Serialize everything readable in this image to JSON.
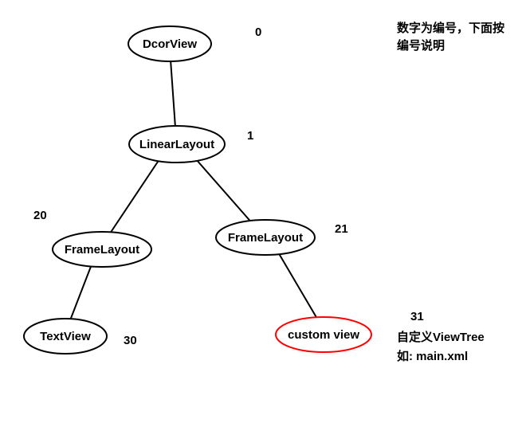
{
  "notes": {
    "top_line1": "数字为编号，下面按",
    "top_line2": "编号说明",
    "custom_line1": "自定义ViewTree",
    "custom_line2": "如: main.xml"
  },
  "nodes": {
    "n0": {
      "label": "DcorView",
      "num": "0"
    },
    "n1": {
      "label": "LinearLayout",
      "num": "1"
    },
    "n20": {
      "label": "FrameLayout",
      "num": "20"
    },
    "n21": {
      "label": "FrameLayout",
      "num": "21"
    },
    "n30": {
      "label": "TextView",
      "num": "30"
    },
    "n31": {
      "label": "custom view",
      "num": "31"
    }
  },
  "chart_data": {
    "type": "tree",
    "title": "",
    "nodes": [
      {
        "id": 0,
        "label": "DcorView",
        "highlight": false
      },
      {
        "id": 1,
        "label": "LinearLayout",
        "highlight": false
      },
      {
        "id": 20,
        "label": "FrameLayout",
        "highlight": false
      },
      {
        "id": 21,
        "label": "FrameLayout",
        "highlight": false
      },
      {
        "id": 30,
        "label": "TextView",
        "highlight": false
      },
      {
        "id": 31,
        "label": "custom view",
        "highlight": true
      }
    ],
    "edges": [
      {
        "from": 0,
        "to": 1
      },
      {
        "from": 1,
        "to": 20
      },
      {
        "from": 1,
        "to": 21
      },
      {
        "from": 20,
        "to": 30
      },
      {
        "from": 21,
        "to": 31
      }
    ],
    "annotations": [
      "数字为编号，下面按编号说明",
      "自定义ViewTree 如: main.xml"
    ]
  }
}
